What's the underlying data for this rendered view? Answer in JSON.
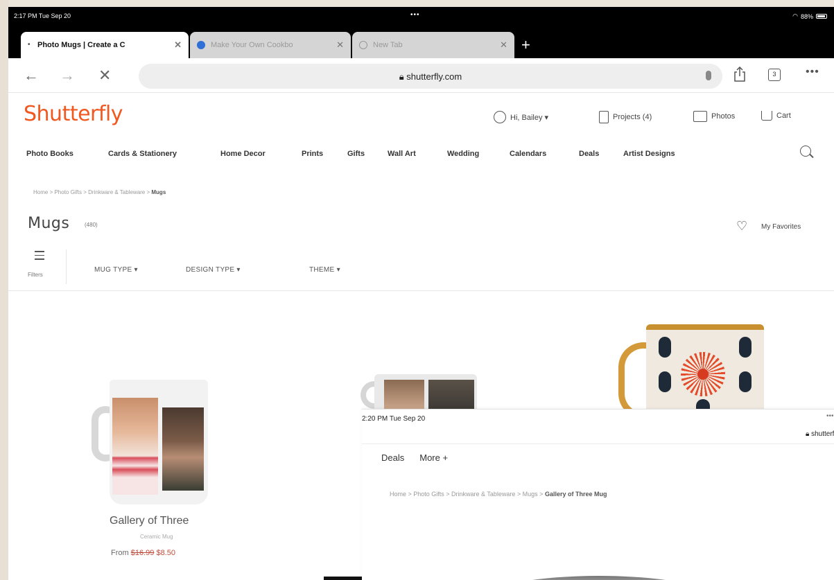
{
  "status_bar": {
    "time": "2:17 PM  Tue Sep 20",
    "dots": "•••",
    "battery": "88%"
  },
  "browser": {
    "tabs": [
      {
        "label": "Photo Mugs | Create a C",
        "active": true
      },
      {
        "label": "Make Your Own Cookbo",
        "active": false
      },
      {
        "label": "New Tab",
        "active": false
      }
    ],
    "close_glyph": "✕",
    "new_tab_glyph": "+",
    "back_glyph": "←",
    "forward_glyph": "→",
    "stop_glyph": "✕",
    "url": "shutterfly.com",
    "tab_count": "3",
    "more_glyph": "•••"
  },
  "site": {
    "logo": "Shutterfly",
    "account": "Hi, Bailey ▾",
    "projects": "Projects (4)",
    "photos": "Photos",
    "cart": "Cart",
    "nav": [
      "Photo Books",
      "Cards & Stationery",
      "Home Decor",
      "Prints",
      "Gifts",
      "Wall Art",
      "Wedding",
      "Calendars",
      "Deals",
      "Artist Designs"
    ],
    "breadcrumb": {
      "path": "Home > Photo Gifts > Drinkware & Tableware > ",
      "current": "Mugs"
    },
    "title": "Mugs",
    "count": "(480)",
    "favorites": "My Favorites",
    "heart_glyph": "♡",
    "filters_label": "Filters",
    "filters": [
      "MUG TYPE ▾",
      "DESIGN TYPE ▾",
      "THEME ▾"
    ]
  },
  "products": [
    {
      "name": "Gallery of Three",
      "subtitle": "Ceramic Mug",
      "price_prefix": "From ",
      "price_old": "$16.99",
      "price_new": "$8.50"
    }
  ],
  "overlay": {
    "time": "2:20 PM  Tue Sep 20",
    "dots": "•••",
    "url": "shutterfly",
    "nav": [
      "Deals",
      "More +"
    ],
    "breadcrumb": {
      "path": "Home > Photo Gifts > Drinkware & Tableware > Mugs > ",
      "current": "Gallery of Three Mug"
    }
  },
  "colors": {
    "brand": "#f0581f",
    "sale": "#c04b3a"
  }
}
